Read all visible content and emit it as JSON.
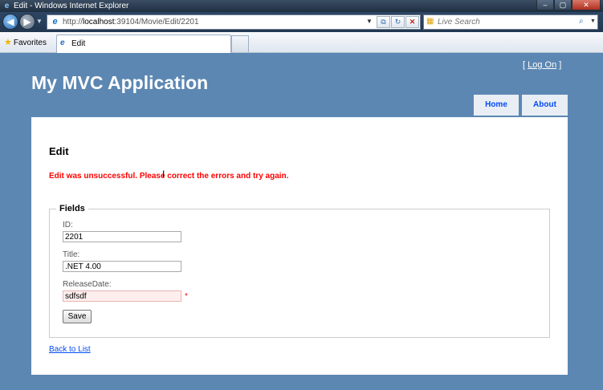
{
  "window": {
    "title": "Edit - Windows Internet Explorer",
    "minimize_glyph": "–",
    "maximize_glyph": "▢",
    "close_glyph": "✕"
  },
  "browser": {
    "url_prefix": "http://",
    "url_host": "localhost",
    "url_rest": ":39104/Movie/Edit/2201",
    "search_placeholder": "Live Search",
    "favorites_label": "Favorites",
    "tab_label": "Edit"
  },
  "site": {
    "login_bracket_open": "[",
    "login_link": "Log On",
    "login_bracket_close": "]",
    "title": "My MVC Application",
    "menu": [
      {
        "label": "Home"
      },
      {
        "label": "About"
      }
    ]
  },
  "page": {
    "heading": "Edit",
    "validation_summary": "Edit was unsuccessful. Please correct the errors and try again.",
    "legend": "Fields",
    "fields": [
      {
        "label": "ID:",
        "value": "2201"
      },
      {
        "label": "Title:",
        "value": ".NET 4.00"
      },
      {
        "label": "ReleaseDate:",
        "value": "sdfsdf"
      }
    ],
    "release_date_error": "*",
    "save_label": "Save",
    "back_link": "Back to List"
  },
  "colors": {
    "page_background": "#5c87b2",
    "error": "#ff0000",
    "link": "#034af3",
    "menu_tab": "#e8eef4"
  },
  "icons": {
    "back": "back-arrow-icon",
    "forward": "forward-arrow-icon",
    "refresh": "refresh-icon",
    "stop": "stop-icon",
    "search": "search-icon",
    "favorites": "star-icon",
    "tab": "ie-page-icon",
    "cursor": "text-cursor-icon"
  }
}
